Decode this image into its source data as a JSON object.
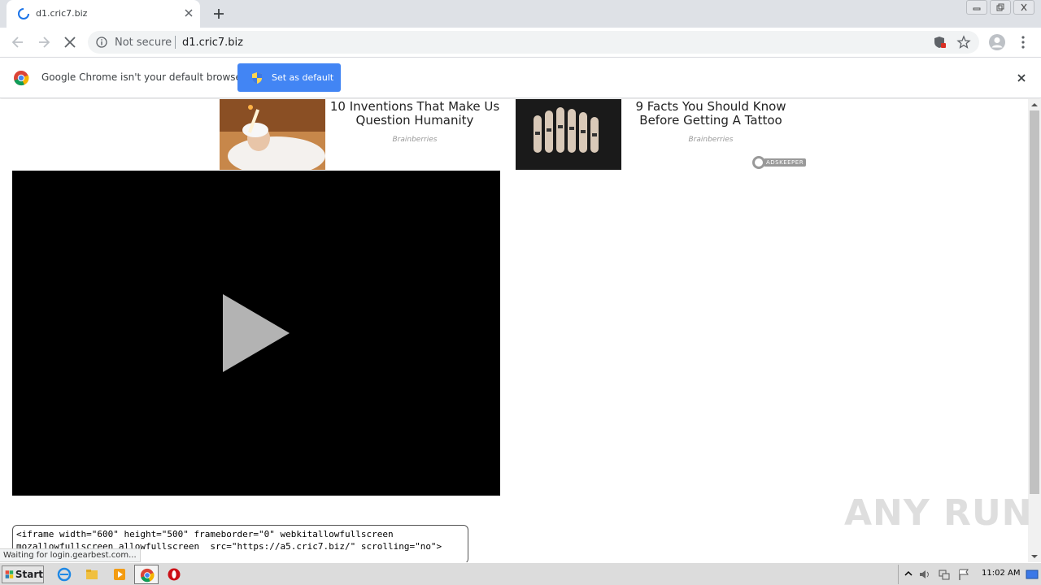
{
  "browser": {
    "tab_title": "d1.cric7.biz",
    "security_label": "Not secure",
    "url": "d1.cric7.biz"
  },
  "infobar": {
    "message": "Google Chrome isn't your default browser",
    "button_label": "Set as default"
  },
  "ads": [
    {
      "title": "10 Inventions That Make Us Question Humanity",
      "source": "Brainberries"
    },
    {
      "title": "9 Facts You Should Know Before Getting A Tattoo",
      "source": "Brainberries"
    }
  ],
  "ad_network": "ADSKEEPER",
  "embed_code": "<iframe width=\"600\" height=\"500\" frameborder=\"0\" webkitallowfullscreen\nmozallowfullscreen allowfullscreen  src=\"https://a5.cric7.biz/\" scrolling=\"no\">",
  "status_text": "Waiting for login.gearbest.com...",
  "watermark": "ANY RUN",
  "taskbar": {
    "start_label": "Start",
    "clock": "11:02 AM"
  },
  "colors": {
    "accent": "#4285f4",
    "video_bg": "#000000",
    "tabstrip_bg": "#dee1e6"
  }
}
